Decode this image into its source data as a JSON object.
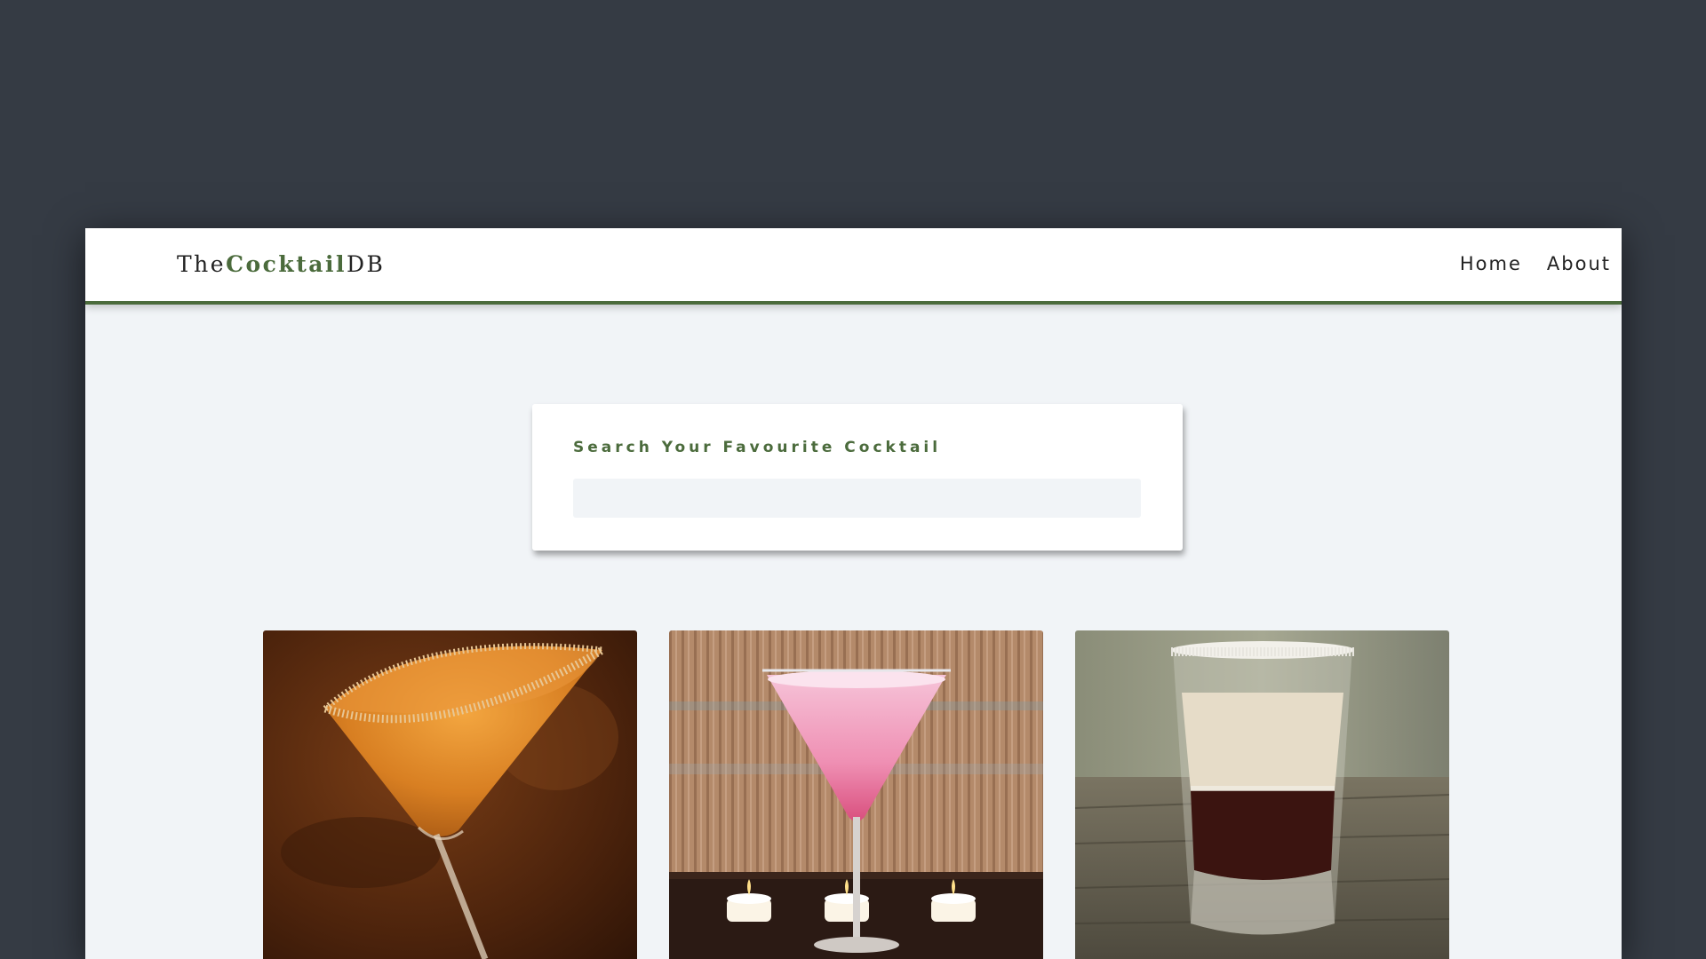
{
  "navbar": {
    "logo_prefix": "The",
    "logo_accent": "Cocktail",
    "logo_suffix": "DB",
    "links": [
      "Home",
      "About"
    ]
  },
  "search": {
    "label": "Search Your Favourite Cocktail",
    "value": "",
    "placeholder": ""
  },
  "cocktails": [
    {
      "image": "orange-martini-with-sugar-rim"
    },
    {
      "image": "pink-martini-with-candles"
    },
    {
      "image": "layered-shot-with-salt-rim"
    }
  ],
  "colors": {
    "background": "#353b44",
    "accent": "#4b6b3c",
    "page": "#f1f4f7"
  }
}
